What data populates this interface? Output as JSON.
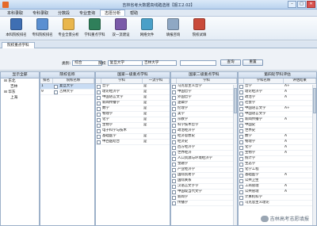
{
  "window": {
    "title": "吉林省考大数据高线踏选账【报工2.02】",
    "buttons": [
      "–",
      "□",
      "✕"
    ]
  },
  "menu": [
    "本科录取",
    "专科录取",
    "分数段",
    "专业查询",
    "志愿分析",
    "帮助"
  ],
  "menu_active_index": 4,
  "toolbar": [
    {
      "label": "本科院校排名",
      "icon": "ranking-icon",
      "color_class": "ico-a"
    },
    {
      "label": "专科院校排名",
      "icon": "chart-icon",
      "color_class": "ico-b"
    },
    {
      "label": "专业全景分析",
      "icon": "analysis-icon",
      "color_class": "ico-c"
    },
    {
      "label": "学科重点学科",
      "icon": "discipline-icon",
      "color_class": "ico-d"
    },
    {
      "label": "双一流建设",
      "icon": "double-first-class-icon",
      "color_class": "ico-e"
    },
    {
      "label": "网络文件",
      "icon": "network-file-icon",
      "color_class": "ico-f"
    },
    {
      "label": "填报咨询",
      "icon": "consult-icon",
      "color_class": "ico-g"
    },
    {
      "label": "院校试填",
      "icon": "trial-fill-icon",
      "color_class": "ico-h"
    }
  ],
  "doc_tab": "院校重点学科",
  "filter": {
    "category_label": "类别:",
    "category_value": "综合",
    "school_label": "院校",
    "school_value": "复旦大学",
    "school2_value": "吉林大学",
    "search_btn": "查询",
    "reset_btn": "重置"
  },
  "region_panel": {
    "header": "显示全部",
    "nodes": [
      {
        "label": "东北",
        "level": 1
      },
      {
        "label": "吉林",
        "level": 2
      },
      {
        "label": "华东",
        "level": 1
      },
      {
        "label": "上海",
        "level": 2
      }
    ]
  },
  "school_panel": {
    "header": "院校名称",
    "cols": [
      "排名",
      "院校名称"
    ],
    "rows": [
      {
        "rank": "1",
        "name": "复旦大学"
      },
      {
        "rank": "9",
        "name": "吉林大学"
      }
    ]
  },
  "key_panel": {
    "header": "国家一级重点学科",
    "cols": [
      "学科",
      "一流学科"
    ],
    "rows": [
      [
        "哲学",
        "是"
      ],
      [
        "理论经济学",
        "是"
      ],
      [
        "中国语言文学",
        "是"
      ],
      [
        "新闻传播学",
        "是"
      ],
      [
        "数学",
        "是"
      ],
      [
        "物理学",
        "是"
      ],
      [
        "化学",
        "是"
      ],
      [
        "生物学",
        "是"
      ],
      [
        "电子科学与技术",
        ""
      ],
      [
        "基础医学",
        "是"
      ],
      [
        "中西医结合",
        "是"
      ]
    ]
  },
  "second_panel": {
    "header": "国家二级重点学科",
    "cols": [
      "学科"
    ],
    "rows": [
      "马克思主义哲学",
      "中国哲学",
      "外国哲学",
      "逻辑学",
      "伦理学",
      "美学",
      "宗教学",
      "科学技术哲学",
      "政治经济学",
      "经济思想史",
      "经济史",
      "西方经济学",
      "世界经济",
      "人口资源与环境经济学",
      "金融学",
      "产业经济学",
      "国际贸易学",
      "国际关系",
      "汉语言文字学",
      "中国现当代文学",
      "新闻学",
      "传播学"
    ]
  },
  "round4_panel": {
    "header": "第四轮学科评估",
    "cols": [
      "学科名称",
      "评估结果"
    ],
    "rows": [
      [
        "哲学",
        "A+"
      ],
      [
        "理论经济学",
        "A"
      ],
      [
        "政治学",
        "A"
      ],
      [
        "社会学",
        ""
      ],
      [
        "中国语言文学",
        "A+"
      ],
      [
        "中国语言文学",
        ""
      ],
      [
        "新闻传播学",
        "A"
      ],
      [
        "中国史",
        ""
      ],
      [
        "世界史",
        ""
      ],
      [
        "数学",
        "A"
      ],
      [
        "物理学",
        "A"
      ],
      [
        "化学",
        "A"
      ],
      [
        "生物学",
        "A"
      ],
      [
        "统计学",
        ""
      ],
      [
        "生态学",
        ""
      ],
      [
        "化学工程",
        ""
      ],
      [
        "基础医学",
        "A"
      ],
      [
        "公共卫生",
        ""
      ],
      [
        "工商管理",
        "A"
      ],
      [
        "公共管理",
        "A"
      ],
      [
        "计算机科学",
        ""
      ],
      [
        "马克思主义理论",
        ""
      ]
    ]
  },
  "watermark": "吉林高考志愿填报"
}
